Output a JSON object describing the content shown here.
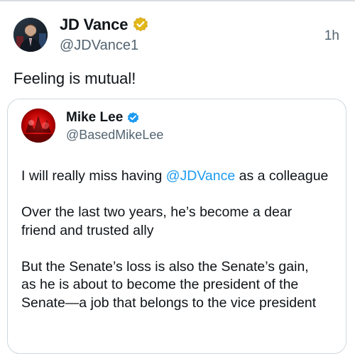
{
  "post": {
    "author": {
      "name": "JD Vance",
      "handle": "@JDVance1",
      "verified": "gold-verified-badge-icon"
    },
    "timestamp": "1h",
    "text": "Feeling is mutual!"
  },
  "quoted_post": {
    "author": {
      "name": "Mike Lee",
      "handle": "@BasedMikeLee",
      "verified": "blue-verified-badge-icon"
    },
    "paragraphs": [
      {
        "lines": [
          {
            "before": "I will really miss having ",
            "mention": "@JDVance",
            "after": " as a colleague"
          }
        ]
      },
      {
        "lines": [
          {
            "text": "Over the last two years, he’s become a dear"
          },
          {
            "text": "friend and trusted ally"
          }
        ]
      },
      {
        "lines": [
          {
            "text": "But the Senate’s loss is also the Senate’s gain,"
          },
          {
            "text": "as he is about to become the president of the"
          },
          {
            "text": "Senate—a job that belongs to the vice president"
          }
        ]
      }
    ]
  },
  "colors": {
    "text": "#0f1419",
    "secondary": "#536471",
    "mention": "#1d9bf0",
    "gold_badge": "#e2b719",
    "blue_badge": "#1d9bf0",
    "card_border": "#cfd9de"
  }
}
